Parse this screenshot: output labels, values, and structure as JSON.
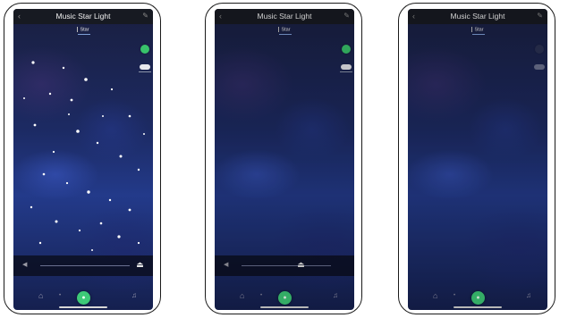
{
  "app": {
    "title": "Music Star Light",
    "tab": "Star"
  },
  "icons": {
    "back": "‹",
    "edit": "✎",
    "volume": "◀",
    "slider_thumb": "⏏",
    "nav_left": "⌂",
    "nav_mid": "•",
    "nav_center": "●",
    "nav_right": "♫"
  },
  "colors": {
    "accent_green": "#3dca78",
    "background_top": "#1a1f40",
    "background_mid": "#233a8a",
    "topbar": "#171a22"
  },
  "screens": [
    {
      "volume_level": 0.95
    },
    {
      "volume_level": 0.55
    },
    {
      "volume_level": null
    }
  ]
}
